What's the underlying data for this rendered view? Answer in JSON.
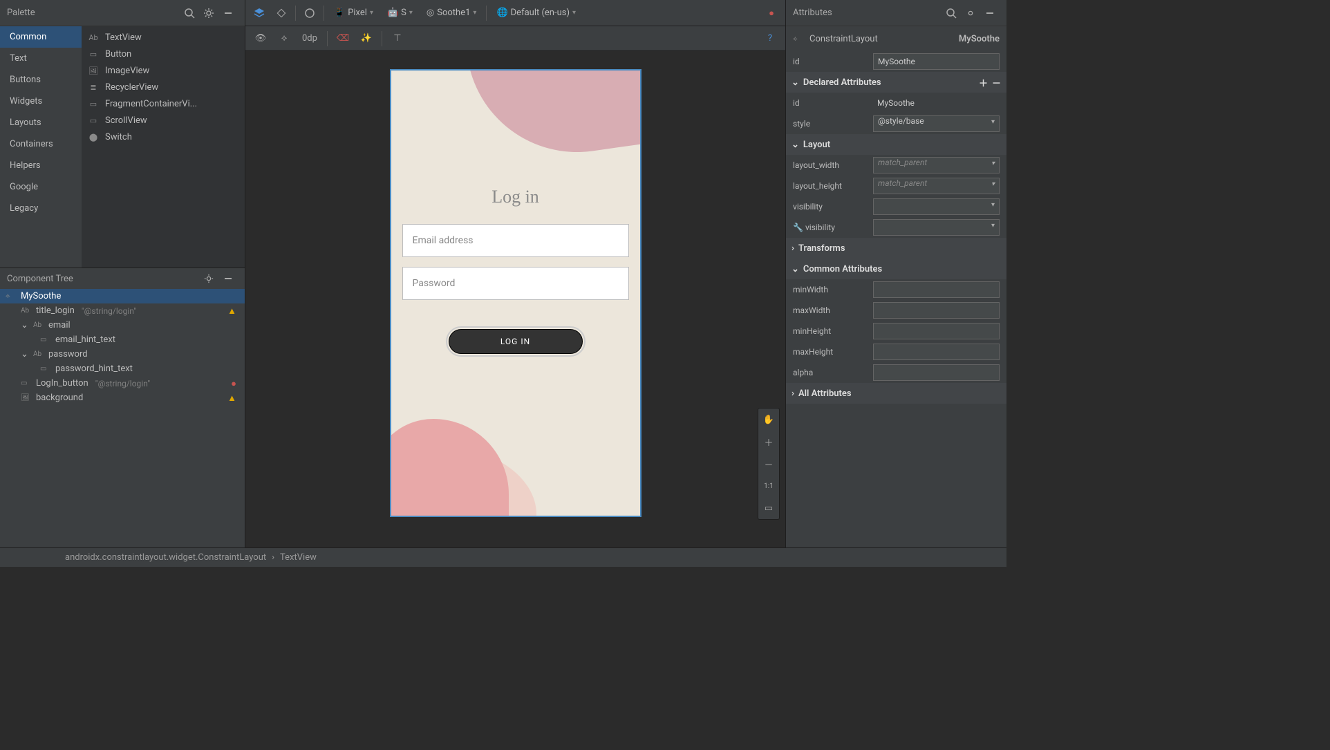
{
  "palette": {
    "title": "Palette",
    "categories": [
      "Common",
      "Text",
      "Buttons",
      "Widgets",
      "Layouts",
      "Containers",
      "Helpers",
      "Google",
      "Legacy"
    ],
    "widgets": [
      {
        "icon": "Ab",
        "name": "TextView"
      },
      {
        "icon": "▭",
        "name": "Button"
      },
      {
        "icon": "🖼",
        "name": "ImageView"
      },
      {
        "icon": "≣",
        "name": "RecyclerView"
      },
      {
        "icon": "▭",
        "name": "FragmentContainerVi..."
      },
      {
        "icon": "▭",
        "name": "ScrollView"
      },
      {
        "icon": "⬤",
        "name": "Switch"
      }
    ]
  },
  "component_tree": {
    "title": "Component Tree",
    "root": {
      "name": "MySoothe",
      "children": [
        {
          "name": "title_login",
          "icon": "Ab",
          "ref": "\"@string/login\"",
          "warn": "warn"
        },
        {
          "name": "email",
          "icon": "Ab",
          "expandable": true,
          "children": [
            {
              "name": "email_hint_text",
              "icon": "▭"
            }
          ]
        },
        {
          "name": "password",
          "icon": "Ab",
          "expandable": true,
          "children": [
            {
              "name": "password_hint_text",
              "icon": "▭"
            }
          ]
        },
        {
          "name": "LogIn_button",
          "icon": "▭",
          "ref": "\"@string/login\"",
          "warn": "err"
        },
        {
          "name": "background",
          "icon": "🖼",
          "warn": "warn"
        }
      ]
    }
  },
  "topbar": {
    "device": "Pixel",
    "api": "S",
    "theme": "Soothe1",
    "locale": "Default (en-us)"
  },
  "center_tools": {
    "dp": "0dp"
  },
  "preview": {
    "title": "Log in",
    "email_hint": "Email address",
    "pass_hint": "Password",
    "button": "LOG IN"
  },
  "attributes": {
    "title": "Attributes",
    "class": "ConstraintLayout",
    "objname": "MySoothe",
    "id_label": "id",
    "id_value": "MySoothe",
    "sections": {
      "declared": "Declared Attributes",
      "layout": "Layout",
      "transforms": "Transforms",
      "common": "Common Attributes",
      "all": "All Attributes"
    },
    "declared": [
      {
        "label": "id",
        "value": "MySoothe"
      },
      {
        "label": "style",
        "value": "@style/base"
      }
    ],
    "layout": [
      {
        "label": "layout_width",
        "value": "match_parent",
        "placeholder": true
      },
      {
        "label": "layout_height",
        "value": "match_parent",
        "placeholder": true
      },
      {
        "label": "visibility",
        "value": ""
      },
      {
        "label": "visibility",
        "value": "",
        "prefix": "🔧"
      }
    ],
    "common": [
      {
        "label": "minWidth",
        "value": ""
      },
      {
        "label": "maxWidth",
        "value": ""
      },
      {
        "label": "minHeight",
        "value": ""
      },
      {
        "label": "maxHeight",
        "value": ""
      },
      {
        "label": "alpha",
        "value": ""
      }
    ]
  },
  "breadcrumb": {
    "a": "androidx.constraintlayout.widget.ConstraintLayout",
    "b": "TextView"
  }
}
